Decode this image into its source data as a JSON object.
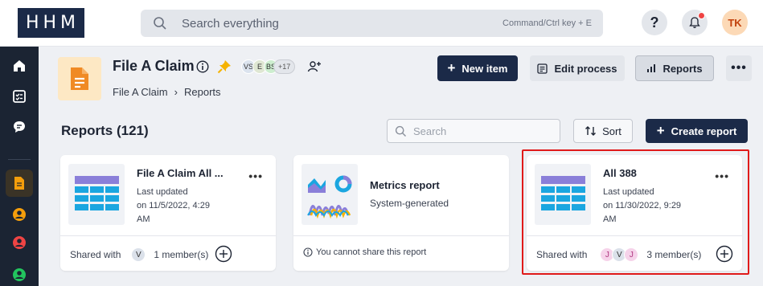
{
  "app": {
    "logo": "HHM"
  },
  "topbar": {
    "search_placeholder": "Search everything",
    "search_hint": "Command/Ctrl key + E",
    "help_label": "?",
    "user_initials": "TK",
    "icons": [
      "search-icon",
      "help-icon",
      "bell-icon"
    ]
  },
  "rail": {
    "items": [
      "home-icon",
      "tasks-icon",
      "chat-icon",
      "document-icon",
      "user-circle-icon",
      "user-circle-icon",
      "user-circle-icon"
    ],
    "colors": {
      "bg": "#1b2433",
      "accent": "#f59e0b",
      "red": "#ef4444",
      "green": "#22c55e"
    }
  },
  "header": {
    "title": "File A Claim",
    "members": [
      "VS",
      "E",
      "BS"
    ],
    "more_members": "+17",
    "breadcrumb": [
      "File A Claim",
      "Reports"
    ],
    "buttons": {
      "new_item": "New item",
      "edit_process": "Edit process",
      "reports": "Reports",
      "more": "•••"
    }
  },
  "reports": {
    "heading": "Reports (121)",
    "search_placeholder": "Search",
    "sort_label": "Sort",
    "create_label": "Create report",
    "cards": [
      {
        "name": "File A Claim All ...",
        "meta": [
          "Last updated",
          "on 11/5/2022, 4:29",
          "AM"
        ],
        "shared_label": "Shared with",
        "members": [
          "V"
        ],
        "member_count": "1 member(s)"
      },
      {
        "name": "Metrics report",
        "meta": [
          "System-generated"
        ],
        "footer_note": "You cannot share this report"
      },
      {
        "name": "All 388",
        "meta": [
          "Last updated",
          "on 11/30/2022, 9:29",
          "AM"
        ],
        "shared_label": "Shared with",
        "members": [
          "J",
          "V",
          "J"
        ],
        "member_count": "3 member(s)",
        "selected": true
      }
    ],
    "more": "•••"
  },
  "colors": {
    "navy": "#1b2a48",
    "highlight": "#e01a1a",
    "table_blue": "#1ba6e0",
    "table_purple": "#8a7fd9"
  }
}
